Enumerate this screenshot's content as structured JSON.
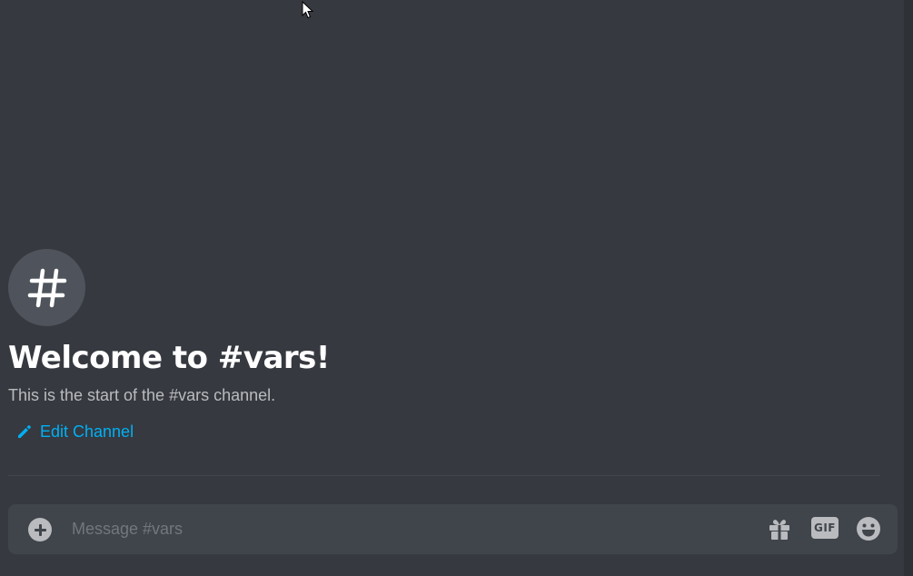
{
  "channel": {
    "name": "vars",
    "welcome_title": "Welcome to #vars!",
    "welcome_subtitle": "This is the start of the #vars channel.",
    "edit_label": "Edit Channel",
    "icon": "hashtag-icon"
  },
  "composer": {
    "placeholder": "Message #vars",
    "value": "",
    "add_icon": "plus-circle-icon",
    "gift_icon": "gift-icon",
    "gif_label": "GIF",
    "emoji_icon": "smiley-emoji-icon"
  },
  "colors": {
    "background": "#36393f",
    "composer_background": "#40444b",
    "accent_link": "#00b0f4",
    "title_text": "#ffffff",
    "muted_text": "#b9bbbe",
    "placeholder_text": "#72767d"
  }
}
